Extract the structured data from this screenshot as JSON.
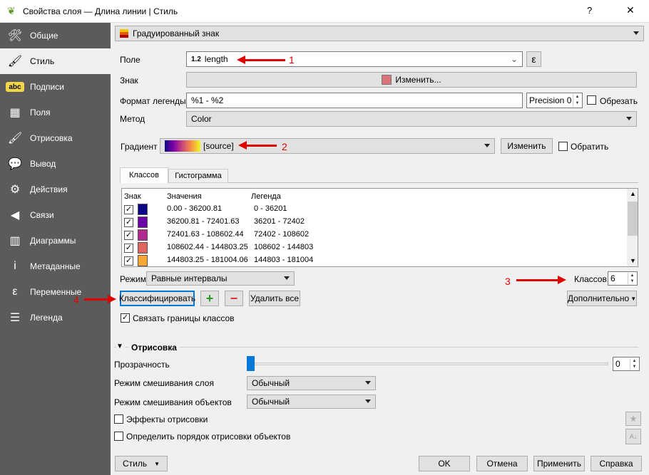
{
  "window": {
    "title": "Свойства слоя — Длина линии | Стиль",
    "help": "?",
    "close": "✕"
  },
  "sidebar": {
    "items": [
      {
        "label": "Общие",
        "icon": "tools-icon",
        "glyph": "🛠"
      },
      {
        "label": "Стиль",
        "icon": "paintbrush-icon",
        "glyph": "🖌"
      },
      {
        "label": "Подписи",
        "icon": "abc-label-icon",
        "glyph": "abc"
      },
      {
        "label": "Поля",
        "icon": "table-icon",
        "glyph": "▦"
      },
      {
        "label": "Отрисовка",
        "icon": "brush-icon",
        "glyph": "🖌"
      },
      {
        "label": "Вывод",
        "icon": "speech-bubble-icon",
        "glyph": "💬"
      },
      {
        "label": "Действия",
        "icon": "gear-icon",
        "glyph": "⚙"
      },
      {
        "label": "Связи",
        "icon": "join-icon",
        "glyph": "◀"
      },
      {
        "label": "Диаграммы",
        "icon": "chart-icon",
        "glyph": "▥"
      },
      {
        "label": "Метаданные",
        "icon": "info-icon",
        "glyph": "i"
      },
      {
        "label": "Переменные",
        "icon": "epsilon-icon",
        "glyph": "ε"
      },
      {
        "label": "Легенда",
        "icon": "legend-icon",
        "glyph": "☰"
      }
    ],
    "selected": 1
  },
  "renderer": {
    "label": "Градуированный знак"
  },
  "form": {
    "field_label": "Поле",
    "field_type": "1.2",
    "field_value": "length",
    "expr_button": "ε",
    "symbol_label": "Знак",
    "symbol_button": "Изменить...",
    "symbol_color": "#d9737a",
    "legend_format_label": "Формат легенды",
    "legend_format_value": "%1 - %2",
    "precision": "Precision 0",
    "trim_label": "Обрезать",
    "method_label": "Метод",
    "method_value": "Color",
    "gradient_label": "Градиент",
    "gradient_value": "[source]",
    "gradient_change": "Изменить",
    "invert_label": "Обратить"
  },
  "tabs": [
    {
      "label": "Классов",
      "active": true
    },
    {
      "label": "Гистограмма",
      "active": false
    }
  ],
  "table": {
    "headers": [
      "Знак",
      "Значения",
      "Легенда"
    ],
    "rows": [
      {
        "checked": true,
        "color": "#0d0887",
        "values": "0.00 - 36200.81",
        "legend": "0 - 36201"
      },
      {
        "checked": true,
        "color": "#6a00a8",
        "values": "36200.81 - 72401.63",
        "legend": "36201 - 72402"
      },
      {
        "checked": true,
        "color": "#b12a90",
        "values": "72401.63 - 108602.44",
        "legend": "72402 - 108602"
      },
      {
        "checked": true,
        "color": "#e16462",
        "values": "108602.44 - 144803.25",
        "legend": "108602 - 144803"
      },
      {
        "checked": true,
        "color": "#fca636",
        "values": "144803.25 - 181004.06",
        "legend": "144803 - 181004"
      }
    ]
  },
  "mode": {
    "label": "Режим",
    "value": "Равные интервалы"
  },
  "classes": {
    "label": "Классов",
    "value": "6"
  },
  "buttons": {
    "classify": "Классифицировать",
    "add": "+",
    "remove": "−",
    "delete_all": "Удалить все",
    "advanced": "Дополнительно"
  },
  "link_bounds": {
    "label": "Связать границы классов",
    "checked": true
  },
  "rendering": {
    "header": "Отрисовка",
    "opacity_label": "Прозрачность",
    "opacity_value": "0",
    "layer_blend_label": "Режим смешивания слоя",
    "layer_blend_value": "Обычный",
    "feature_blend_label": "Режим смешивания объектов",
    "feature_blend_value": "Обычный",
    "effects_label": "Эффекты отрисовки",
    "order_label": "Определить порядок отрисовки объектов"
  },
  "footer": {
    "style": "Стиль",
    "ok": "OK",
    "cancel": "Отмена",
    "apply": "Применить",
    "help": "Справка"
  },
  "annotations": [
    "1",
    "2",
    "3",
    "4"
  ],
  "colors": {
    "annotation": "#e00000",
    "sidebar": "#5b5b5b",
    "focus": "#0078d7"
  }
}
